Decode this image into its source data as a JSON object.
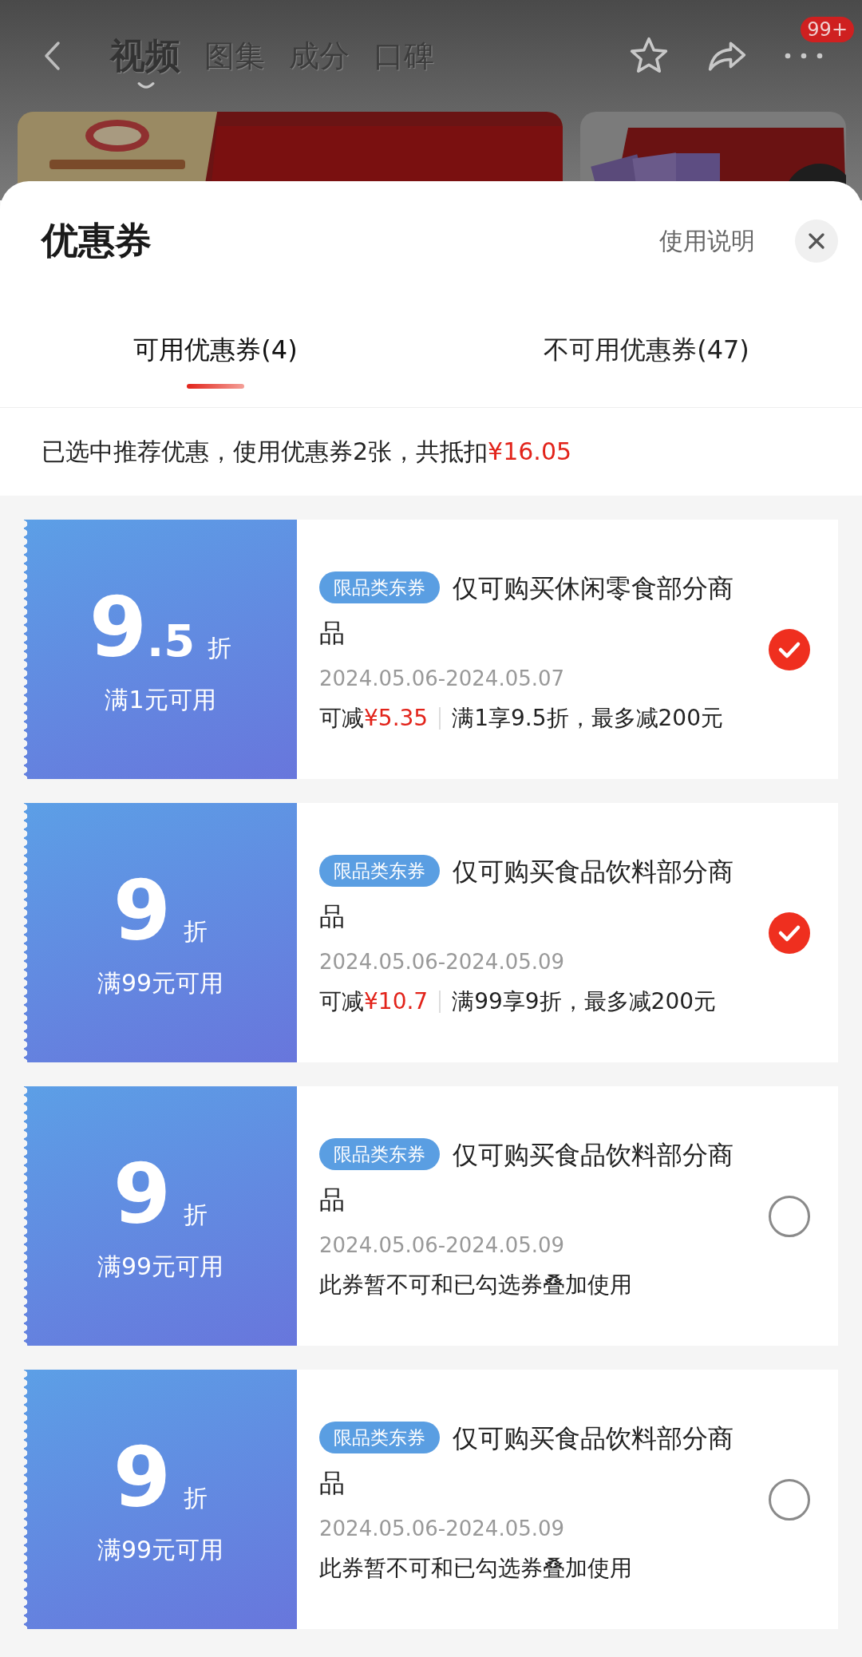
{
  "top_bar": {
    "tabs": [
      {
        "label": "视频",
        "selected": true
      },
      {
        "label": "图集",
        "selected": false
      },
      {
        "label": "成分",
        "selected": false
      },
      {
        "label": "口碑",
        "selected": false
      }
    ],
    "badge": "99+"
  },
  "sheet": {
    "title": "优惠券",
    "help_link": "使用说明"
  },
  "tabs": [
    {
      "label": "可用优惠券(4)",
      "selected": true
    },
    {
      "label": "不可用优惠券(47)",
      "selected": false
    }
  ],
  "summary": {
    "text": "已选中推荐优惠，使用优惠券2张，共抵扣",
    "amount": "¥16.05"
  },
  "coupons": [
    {
      "value": "9",
      "decimal": ".5",
      "unit": "折",
      "condition": "满1元可用",
      "tag": "限品类东券",
      "title": "仅可购买休闲零食部分商品",
      "dates": "2024.05.06-2024.05.07",
      "kind": "savings",
      "savings_label": "可减",
      "savings": "¥5.35",
      "rule": "满1享9.5折，最多减200元",
      "selected": true
    },
    {
      "value": "9",
      "unit": "折",
      "condition": "满99元可用",
      "tag": "限品类东券",
      "title": "仅可购买食品饮料部分商品",
      "dates": "2024.05.06-2024.05.09",
      "kind": "savings",
      "savings_label": "可减",
      "savings": "¥10.7",
      "rule": "满99享9折，最多减200元",
      "selected": true
    },
    {
      "value": "9",
      "unit": "折",
      "condition": "满99元可用",
      "tag": "限品类东券",
      "title": "仅可购买食品饮料部分商品",
      "dates": "2024.05.06-2024.05.09",
      "kind": "notice",
      "note": "此券暂不可和已勾选券叠加使用",
      "selected": false
    },
    {
      "value": "9",
      "unit": "折",
      "condition": "满99元可用",
      "tag": "限品类东券",
      "title": "仅可购买食品饮料部分商品",
      "dates": "2024.05.06-2024.05.09",
      "kind": "notice",
      "note": "此券暂不可和已勾选券叠加使用",
      "selected": false
    }
  ]
}
